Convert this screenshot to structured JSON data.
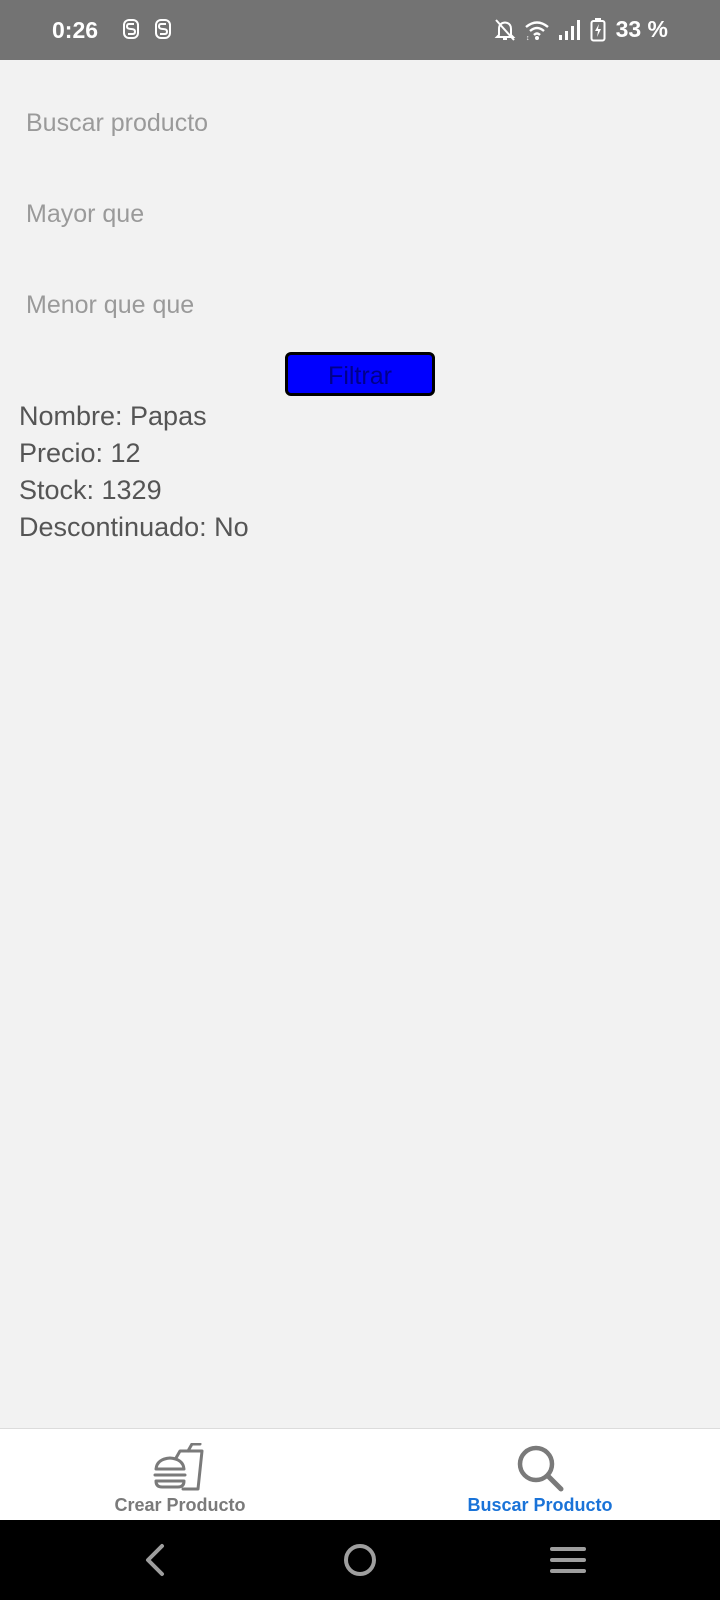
{
  "status_bar": {
    "time": "0:26",
    "battery_text": "33 %",
    "icons": [
      "s-app-icon",
      "s-app-icon",
      "bell-off-icon",
      "wifi-icon",
      "signal-icon",
      "battery-charging-icon"
    ]
  },
  "search_form": {
    "search_placeholder": "Buscar producto",
    "greater_than_placeholder": "Mayor que",
    "less_than_placeholder": "Menor que que",
    "filter_button_label": "Filtrar",
    "filter_button_color": "#0000ff"
  },
  "result": {
    "name_line": "Nombre: Papas",
    "price_line": "Precio: 12",
    "stock_line": "Stock: 1329",
    "discontinued_line": "Descontinuado: No"
  },
  "bottom_nav": {
    "items": [
      {
        "label": "Crear Producto",
        "icon": "fast-food-icon",
        "active": false
      },
      {
        "label": "Buscar Producto",
        "icon": "search-icon",
        "active": true
      }
    ],
    "active_color": "#1a73d8",
    "inactive_color": "#7a7a7a"
  },
  "system_nav": {
    "icons": [
      "back-icon",
      "home-icon",
      "recents-icon"
    ]
  }
}
